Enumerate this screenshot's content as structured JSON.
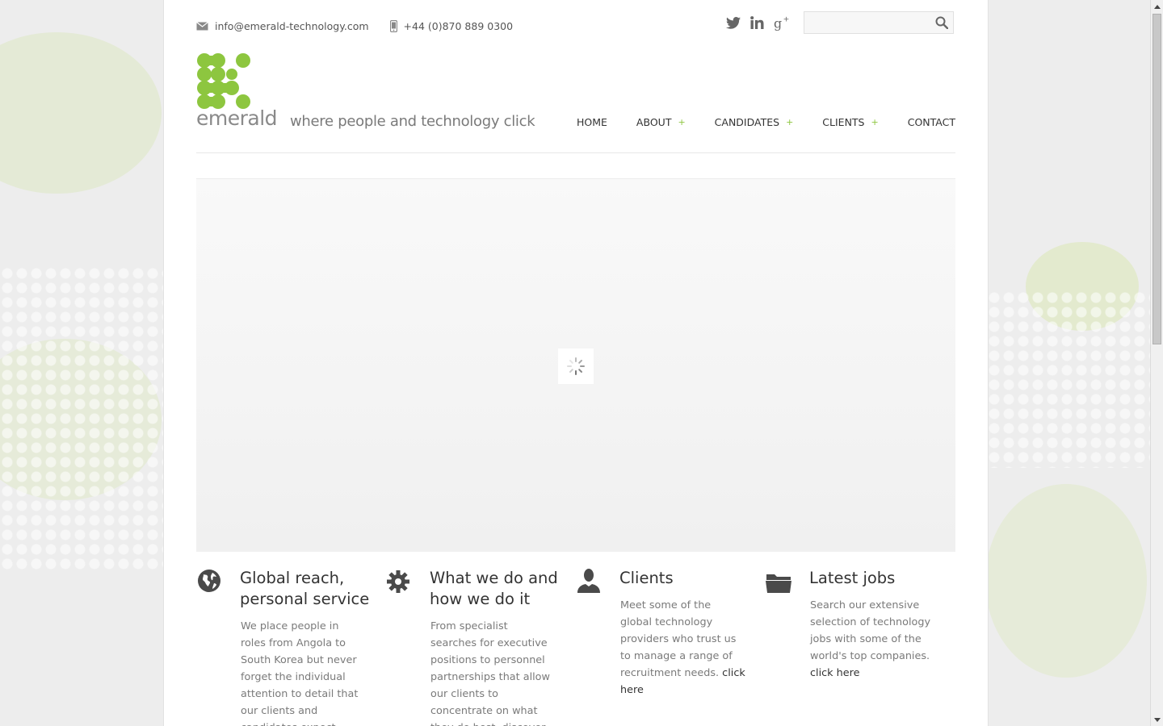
{
  "topbar": {
    "email": "info@emerald-technology.com",
    "phone": "+44 (0)870 889 0300",
    "social": [
      "twitter-icon",
      "linkedin-icon",
      "google-plus-icon"
    ],
    "search_placeholder": ""
  },
  "brand": {
    "name": "emerald",
    "tagline": "where people and technology click",
    "color": "#8dc63f"
  },
  "nav": {
    "items": [
      {
        "label": "HOME",
        "has_sub": false
      },
      {
        "label": "ABOUT",
        "has_sub": true
      },
      {
        "label": "CANDIDATES",
        "has_sub": true
      },
      {
        "label": "CLIENTS",
        "has_sub": true
      },
      {
        "label": "CONTACT",
        "has_sub": false
      }
    ],
    "plus": "+"
  },
  "features": [
    {
      "icon": "globe-icon",
      "title": "Global reach, personal service",
      "text": "We place people in roles from Angola to South Korea but never forget the individual attention to detail that our clients and candidates expect.",
      "link": ""
    },
    {
      "icon": "gear-icon",
      "title": "What we do and how we do it",
      "text": "From specialist searches for executive positions to personnel partnerships that allow our clients to concentrate on what they do best, discover what we can do for you.",
      "link": ""
    },
    {
      "icon": "person-icon",
      "title": "Clients",
      "text": "Meet some of the global technology providers who trust us to manage a range of recruitment needs.",
      "link": "click here"
    },
    {
      "icon": "folder-icon",
      "title": "Latest jobs",
      "text": "Search our extensive selection of technology jobs with some of the world's top companies.",
      "link": "click here"
    }
  ]
}
